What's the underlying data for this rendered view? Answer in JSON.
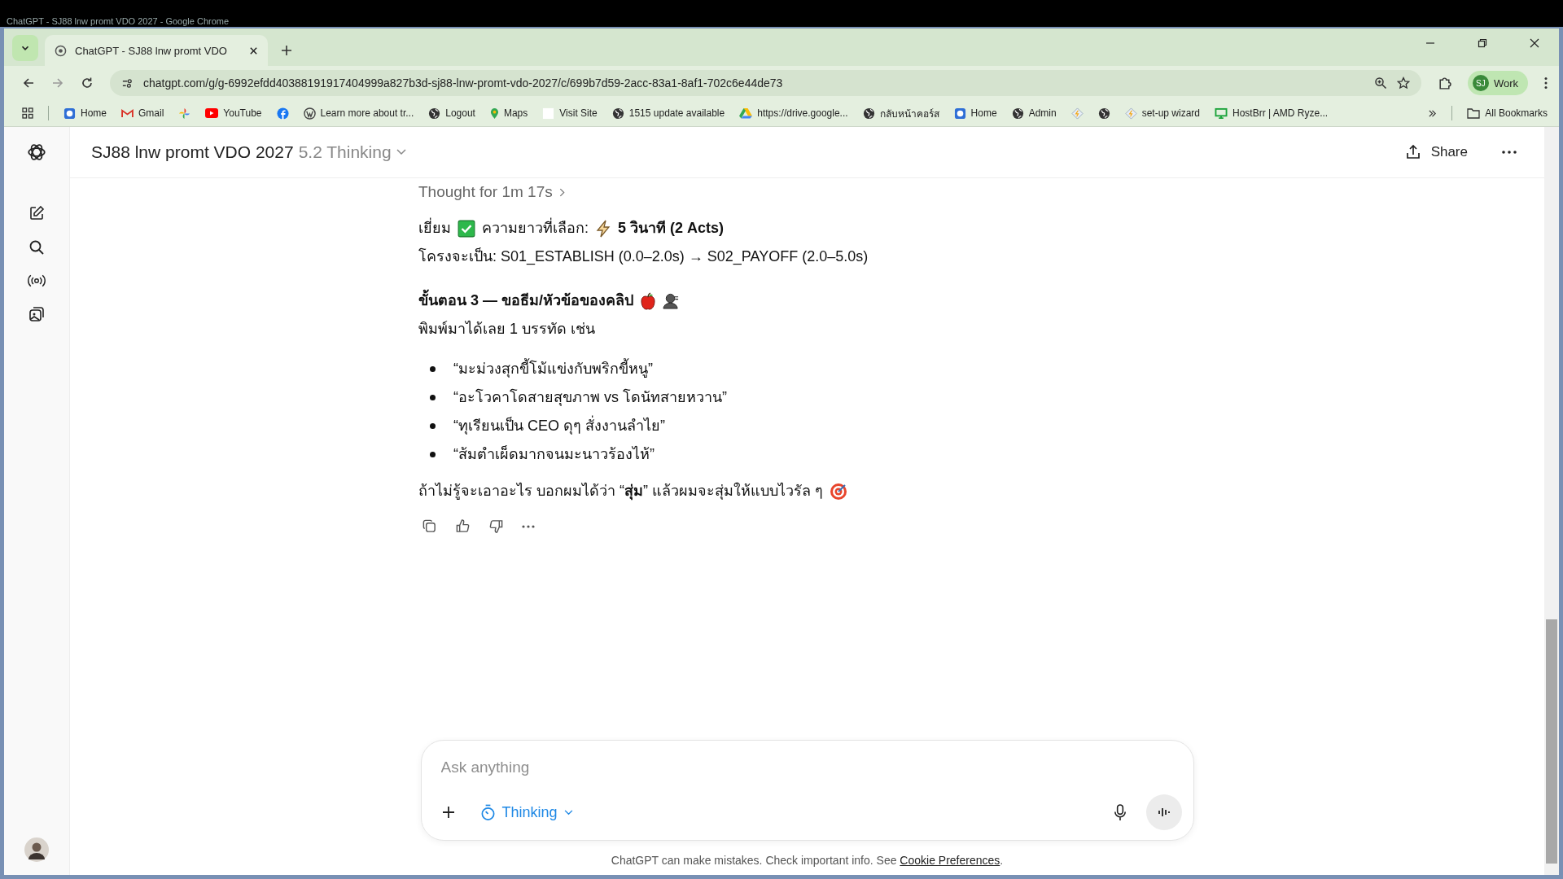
{
  "window": {
    "title": "ChatGPT - SJ88 lnw promt VDO 2027 - Google Chrome"
  },
  "tabs": [
    {
      "title": "ChatGPT - SJ88 lnw promt VDO",
      "selected": true
    }
  ],
  "address": {
    "url": "chatgpt.com/g/g-6992efdd40388191917404999a827b3d-sj88-lnw-promt-vdo-2027/c/699b7d59-2acc-83a1-8af1-702c6e44de73"
  },
  "profile": {
    "initials": "SJ",
    "label": "Work"
  },
  "bookmarks": [
    {
      "kind": "app",
      "label": "Home"
    },
    {
      "kind": "gmail",
      "label": "Gmail"
    },
    {
      "kind": "pinwheel"
    },
    {
      "kind": "youtube",
      "label": "YouTube"
    },
    {
      "kind": "facebook"
    },
    {
      "kind": "wordpress",
      "label": "Learn more about tr..."
    },
    {
      "kind": "globe",
      "label": "Logout"
    },
    {
      "kind": "maps",
      "label": "Maps"
    },
    {
      "kind": "blank",
      "label": "Visit Site"
    },
    {
      "kind": "globe",
      "label": "1515 update available"
    },
    {
      "kind": "drive",
      "label": "https://drive.google..."
    },
    {
      "kind": "globe",
      "label": "กลับหน้าคอร์ส"
    },
    {
      "kind": "app",
      "label": "Home"
    },
    {
      "kind": "globe",
      "label": "Admin"
    },
    {
      "kind": "diamond"
    },
    {
      "kind": "globe"
    },
    {
      "kind": "diamond",
      "label": "set-up wizard"
    },
    {
      "kind": "monitor",
      "label": "HostBrr | AMD Ryze..."
    }
  ],
  "all_bookmarks": "All Bookmarks",
  "chat": {
    "title": "SJ88 lnw promt VDO 2027",
    "model": "5.2 Thinking",
    "share": "Share"
  },
  "message": {
    "thought": "Thought for 1m 17s",
    "intro": {
      "lead": "เยี่ยม",
      "label": "ความยาวที่เลือก:",
      "value": "5 วินาที (2 Acts)"
    },
    "structure": "โครงจะเป็น: S01_ESTABLISH (0.0–2.0s) → S02_PAYOFF (2.0–5.0s)",
    "heading": "ขั้นตอน 3 — ขอธีม/หัวข้อของคลิป",
    "prompt": "พิมพ์มาได้เลย 1 บรรทัด เช่น",
    "examples": [
      "“มะม่วงสุกขี้โม้แข่งกับพริกขี้หนู”",
      "“อะโวคาโดสายสุขภาพ vs โดนัทสายหวาน”",
      "“ทุเรียนเป็น CEO ดุๆ สั่งงานลำไย”",
      "“ส้มตำเผ็ดมากจนมะนาวร้องไห้”"
    ],
    "closing": "ถ้าไม่รู้จะเอาอะไร บอกผมได้ว่า “**สุ่ม**” แล้วผมจะสุ่มให้แบบไวรัล ๆ"
  },
  "composer": {
    "placeholder": "Ask anything",
    "mode": "Thinking"
  },
  "footer": {
    "text": "ChatGPT can make mistakes. Check important info. See",
    "link": "Cookie Preferences",
    "end": "."
  }
}
